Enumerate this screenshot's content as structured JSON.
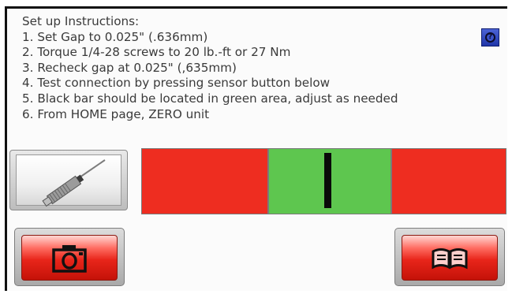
{
  "instructions": {
    "heading": "Set up Instructions:",
    "steps": [
      "1. Set Gap to 0.025\" (.636mm)",
      "2. Torque 1/4-28 screws to 20 lb.-ft or 27 Nm",
      "3. Recheck gap at 0.025\" (,635mm)",
      "4. Test connection by pressing sensor button below",
      "5. Black bar should be located in green area, adjust as needed",
      "6. From HOME page, ZERO unit"
    ]
  },
  "help_button": {
    "icon": "help-icon"
  },
  "sensor_button": {
    "icon": "proximity-sensor-icon"
  },
  "gauge": {
    "zones": [
      "red",
      "green",
      "red"
    ],
    "colors": {
      "red": "#ee2d20",
      "green": "#5ec64f",
      "marker": "#0a0a0a"
    },
    "marker_position_fraction": 0.51
  },
  "camera_button": {
    "icon": "camera-icon",
    "color": "#e8251a"
  },
  "manual_button": {
    "icon": "open-book-icon",
    "color": "#e8251a"
  }
}
